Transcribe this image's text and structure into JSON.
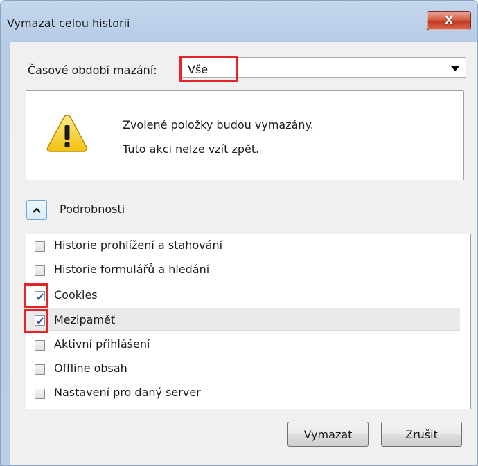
{
  "window": {
    "title": "Vymazat celou historii",
    "close_label": "X"
  },
  "period": {
    "label_before": "Čas",
    "label_accel": "o",
    "label_after": "vé období mazání:",
    "selected_value": "Vše"
  },
  "warning": {
    "line1": "Zvolené položky budou vymazány.",
    "line2": "Tuto akci nelze vzít zpět."
  },
  "details": {
    "label_accel": "P",
    "label_rest": "odrobnosti"
  },
  "items": [
    {
      "label": "Historie prohlížení a stahování",
      "checked": false
    },
    {
      "label": "Historie formulářů a hledání",
      "checked": false
    },
    {
      "label": "Cookies",
      "checked": true
    },
    {
      "label": "Mezipaměť",
      "checked": true
    },
    {
      "label": "Aktivní přihlášení",
      "checked": false
    },
    {
      "label": "Offline obsah",
      "checked": false
    },
    {
      "label": "Nastavení pro daný server",
      "checked": false
    }
  ],
  "buttons": {
    "ok_label": "Vymazat",
    "cancel_label": "Zrušit"
  },
  "colors": {
    "highlight": "#e3242b",
    "close_button": "#c23b22"
  }
}
